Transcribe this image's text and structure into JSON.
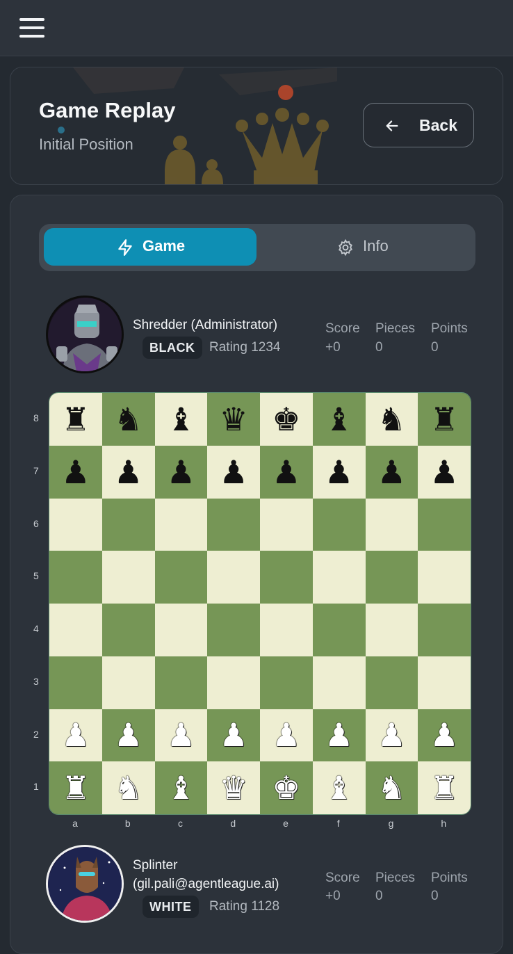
{
  "nav": {
    "menu_icon": "hamburger-menu-icon"
  },
  "header": {
    "title": "Game Replay",
    "subtitle": "Initial Position",
    "back_label": "Back",
    "back_icon": "arrow-left-icon"
  },
  "tabs": [
    {
      "label": "Game",
      "icon": "lightning-icon",
      "active": true
    },
    {
      "label": "Info",
      "icon": "gear-icon",
      "active": false
    }
  ],
  "stat_labels": {
    "score": "Score",
    "pieces": "Pieces",
    "points": "Points"
  },
  "top_player": {
    "name": "Shredder (Administrator)",
    "color": "BLACK",
    "rating": "Rating 1234",
    "score": "+0",
    "pieces": "0",
    "points": "0"
  },
  "bottom_player": {
    "name_line1": "Splinter",
    "name_line2": "(gil.pali@agentleague.ai)",
    "color": "WHITE",
    "rating": "Rating 1128",
    "score": "+0",
    "pieces": "0",
    "points": "0"
  },
  "board": {
    "ranks": [
      "8",
      "7",
      "6",
      "5",
      "4",
      "3",
      "2",
      "1"
    ],
    "files": [
      "a",
      "b",
      "c",
      "d",
      "e",
      "f",
      "g",
      "h"
    ],
    "position": [
      [
        "r",
        "n",
        "b",
        "q",
        "k",
        "b",
        "n",
        "r"
      ],
      [
        "p",
        "p",
        "p",
        "p",
        "p",
        "p",
        "p",
        "p"
      ],
      [
        "",
        "",
        "",
        "",
        "",
        "",
        "",
        ""
      ],
      [
        "",
        "",
        "",
        "",
        "",
        "",
        "",
        ""
      ],
      [
        "",
        "",
        "",
        "",
        "",
        "",
        "",
        ""
      ],
      [
        "",
        "",
        "",
        "",
        "",
        "",
        "",
        ""
      ],
      [
        "P",
        "P",
        "P",
        "P",
        "P",
        "P",
        "P",
        "P"
      ],
      [
        "R",
        "N",
        "B",
        "Q",
        "K",
        "B",
        "N",
        "R"
      ]
    ],
    "light_color": "#eeeed2",
    "dark_color": "#769656"
  },
  "colors": {
    "accent": "#0e8fb4",
    "background": "#242a31"
  }
}
